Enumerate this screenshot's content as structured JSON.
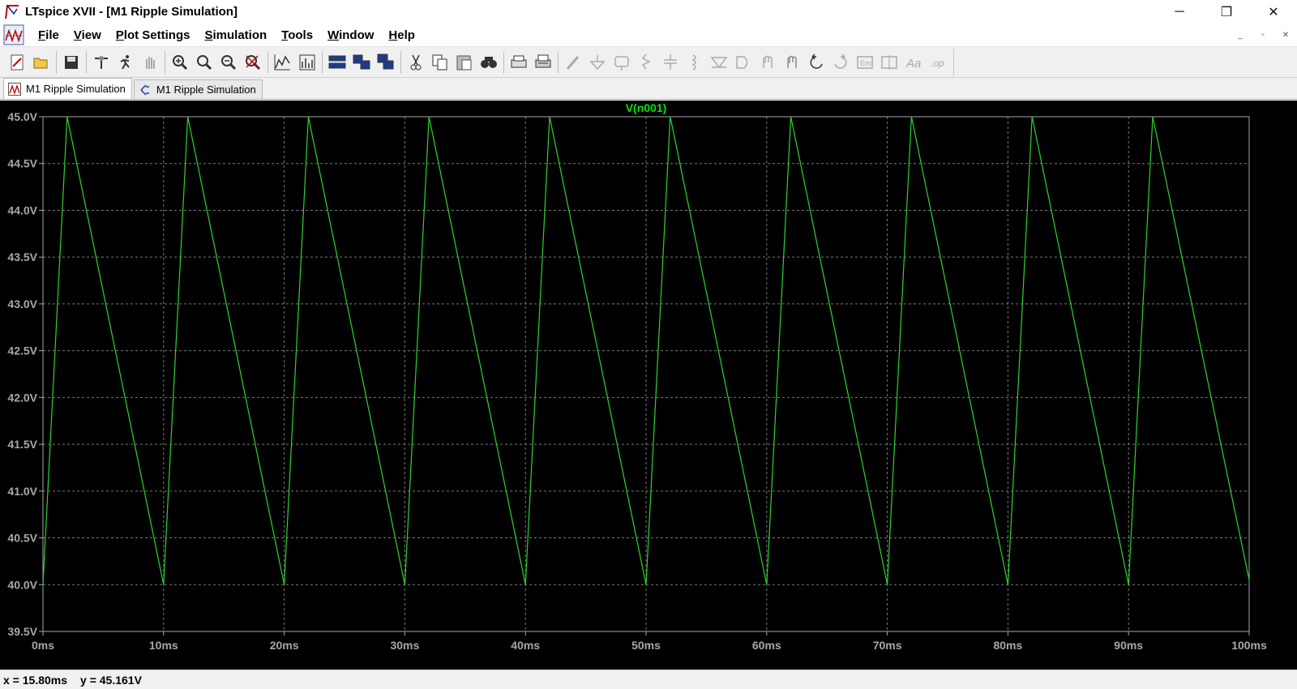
{
  "window": {
    "title": "LTspice XVII - [M1 Ripple Simulation]",
    "controls": {
      "minimize": "─",
      "restore": "❐",
      "close": "✕"
    }
  },
  "menu": {
    "items": [
      {
        "label": "File",
        "underline": "F"
      },
      {
        "label": "View",
        "underline": "V"
      },
      {
        "label": "Plot Settings",
        "underline": "P"
      },
      {
        "label": "Simulation",
        "underline": "S"
      },
      {
        "label": "Tools",
        "underline": "T"
      },
      {
        "label": "Window",
        "underline": "W"
      },
      {
        "label": "Help",
        "underline": "H"
      }
    ],
    "mdi_controls": {
      "minimize": "_",
      "restore": "▫",
      "close": "✕"
    }
  },
  "toolbar": {
    "icons": [
      "new-schematic-icon",
      "open-icon",
      "save-icon",
      "control-panel-icon",
      "run-icon",
      "halt-icon",
      "zoom-in-icon",
      "zoom-area-icon",
      "zoom-out-icon",
      "zoom-cancel-icon",
      "autorange-icon",
      "view-fft-icon",
      "tile-horizontal-icon",
      "tile-vertical-icon",
      "cascade-icon",
      "cut-icon",
      "copy-icon",
      "paste-icon",
      "find-icon",
      "print-preview-icon",
      "print-icon",
      "wire-icon",
      "ground-icon",
      "label-net-icon",
      "resistor-icon",
      "capacitor-icon",
      "inductor-icon",
      "diode-icon",
      "component-icon",
      "move-icon",
      "drag-icon",
      "undo-icon",
      "redo-icon",
      "rotate-icon",
      "mirror-icon",
      "text-icon",
      "spice-directive-icon"
    ]
  },
  "tabs": [
    {
      "label": "M1 Ripple Simulation",
      "kind": "waveform",
      "active": true
    },
    {
      "label": "M1 Ripple Simulation",
      "kind": "schematic",
      "active": false
    }
  ],
  "status": {
    "x_readout": "x = 15.80ms",
    "y_readout": "y = 45.161V"
  },
  "chart_data": {
    "type": "line",
    "title": "V(n001)",
    "xlabel": "",
    "ylabel": "",
    "xlim": [
      0,
      100
    ],
    "ylim": [
      39.5,
      45.0
    ],
    "x_ticks": [
      "0ms",
      "10ms",
      "20ms",
      "30ms",
      "40ms",
      "50ms",
      "60ms",
      "70ms",
      "80ms",
      "90ms",
      "100ms"
    ],
    "y_ticks": [
      "45.0V",
      "44.5V",
      "44.0V",
      "43.5V",
      "43.0V",
      "42.5V",
      "42.0V",
      "41.5V",
      "41.0V",
      "40.5V",
      "40.0V",
      "39.5V"
    ],
    "grid": true,
    "colors": {
      "background": "#000000",
      "trace": "#2ed32e",
      "grid": "#7a7a7a",
      "axis": "#a8a8a8",
      "title": "#00e600"
    },
    "series": [
      {
        "name": "V(n001)",
        "x_ms": [
          0,
          2,
          10,
          12,
          20,
          22,
          30,
          32,
          40,
          42,
          50,
          52,
          60,
          62,
          70,
          72,
          80,
          82,
          90,
          92,
          100
        ],
        "y_volts": [
          40.0,
          45.0,
          40.0,
          45.0,
          40.0,
          45.0,
          40.0,
          45.0,
          40.0,
          45.0,
          40.0,
          45.0,
          40.0,
          45.0,
          40.0,
          45.0,
          40.0,
          45.0,
          40.0,
          45.0,
          40.05
        ]
      }
    ]
  }
}
